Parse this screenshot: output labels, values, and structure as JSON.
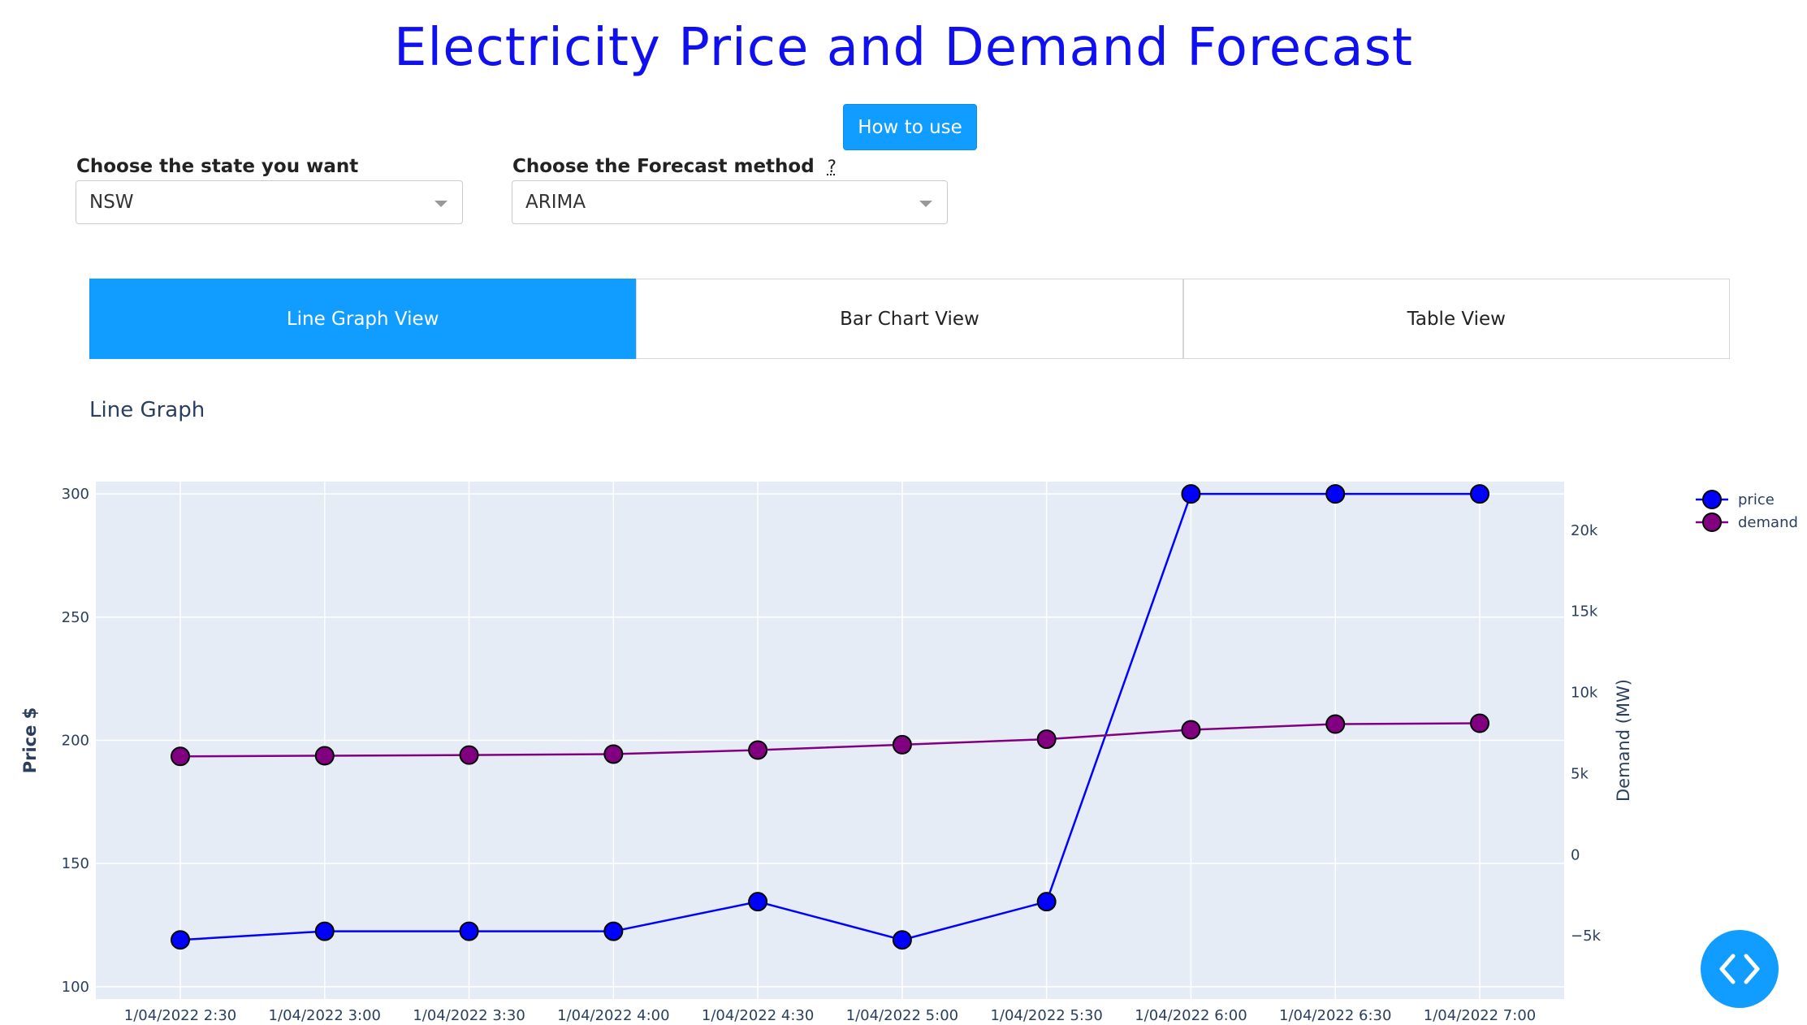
{
  "header": {
    "title": "Electricity Price and Demand Forecast",
    "how_to_use": "How to use"
  },
  "controls": {
    "state_label": "Choose the state you want",
    "state_value": "NSW",
    "method_label": "Choose the Forecast method",
    "method_help": "?",
    "method_value": "ARIMA"
  },
  "tabs": [
    {
      "label": "Line Graph View",
      "active": true
    },
    {
      "label": "Bar Chart View",
      "active": false
    },
    {
      "label": "Table View",
      "active": false
    }
  ],
  "section_title": "Line Graph",
  "colors": {
    "accent": "#119dff",
    "title": "#1010ee",
    "price": "#0000ff",
    "demand": "#800080",
    "plot_bg": "#e5ecf6"
  },
  "chart_data": {
    "type": "line",
    "x": [
      "1/04/2022 2:30",
      "1/04/2022 3:00",
      "1/04/2022 3:30",
      "1/04/2022 4:00",
      "1/04/2022 4:30",
      "1/04/2022 5:00",
      "1/04/2022 5:30",
      "1/04/2022 6:00",
      "1/04/2022 6:30",
      "1/04/2022 7:00"
    ],
    "series": [
      {
        "name": "price",
        "axis": "left",
        "color": "#0000ff",
        "values": [
          119,
          122.5,
          122.5,
          122.5,
          134.5,
          119,
          134.5,
          300,
          300,
          300
        ]
      },
      {
        "name": "demand",
        "axis": "right",
        "color": "#800080",
        "values": [
          6060,
          6100,
          6140,
          6200,
          6450,
          6780,
          7120,
          7700,
          8050,
          8100
        ]
      }
    ],
    "ylabel": "Price $",
    "ylabel_right": "Demand (MW)",
    "y_ticks": [
      100,
      150,
      200,
      250,
      300
    ],
    "y2_ticks": [
      -5000,
      0,
      5000,
      10000,
      15000,
      20000
    ],
    "y2_tick_labels": [
      "−5k",
      "0",
      "5k",
      "10k",
      "15k",
      "20k"
    ],
    "ylim": [
      95,
      305
    ],
    "y2lim": [
      -8900,
      23000
    ],
    "grid": true,
    "legend": "top-right"
  }
}
